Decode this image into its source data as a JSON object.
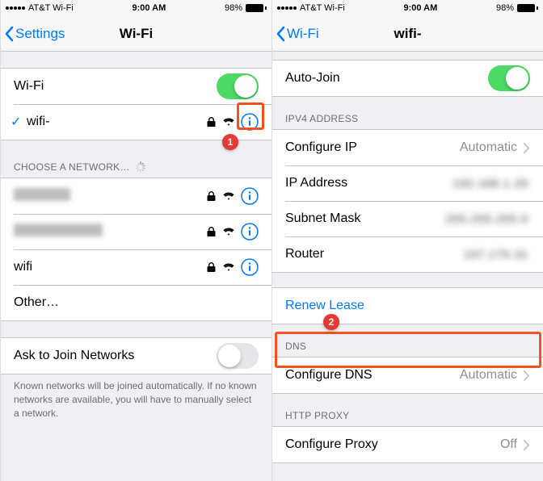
{
  "left": {
    "status": {
      "carrier": "AT&T Wi-Fi",
      "time": "9:00 AM",
      "battery": "98%"
    },
    "nav": {
      "back": "Settings",
      "title": "Wi-Fi"
    },
    "wifi_toggle_label": "Wi-Fi",
    "connected_network": "wifi-",
    "section_choose": "CHOOSE A NETWORK…",
    "networks": [
      {
        "name": "",
        "blurred": true
      },
      {
        "name": "",
        "blurred": true,
        "wide": true
      },
      {
        "name": "wifi"
      }
    ],
    "other_label": "Other…",
    "ask_join_label": "Ask to Join Networks",
    "ask_join_footer": "Known networks will be joined automatically. If no known networks are available, you will have to manually select a network.",
    "callout1": "1"
  },
  "right": {
    "status": {
      "carrier": "AT&T Wi-Fi",
      "time": "9:00 AM",
      "battery": "98%"
    },
    "nav": {
      "back": "Wi-Fi",
      "title": "wifi-"
    },
    "autojoin_label": "Auto-Join",
    "ipv4_header": "IPV4 ADDRESS",
    "rows": {
      "configure_ip_label": "Configure IP",
      "configure_ip_value": "Automatic",
      "ip_label": "IP Address",
      "ip_value": "192.168.1.29",
      "subnet_label": "Subnet Mask",
      "subnet_value": "255.255.255.0",
      "router_label": "Router",
      "router_value": "107.170.31"
    },
    "renew_lease": "Renew Lease",
    "dns_header": "DNS",
    "configure_dns_label": "Configure DNS",
    "configure_dns_value": "Automatic",
    "http_proxy_header": "HTTP PROXY",
    "configure_proxy_label": "Configure Proxy",
    "configure_proxy_value": "Off",
    "callout2": "2"
  }
}
